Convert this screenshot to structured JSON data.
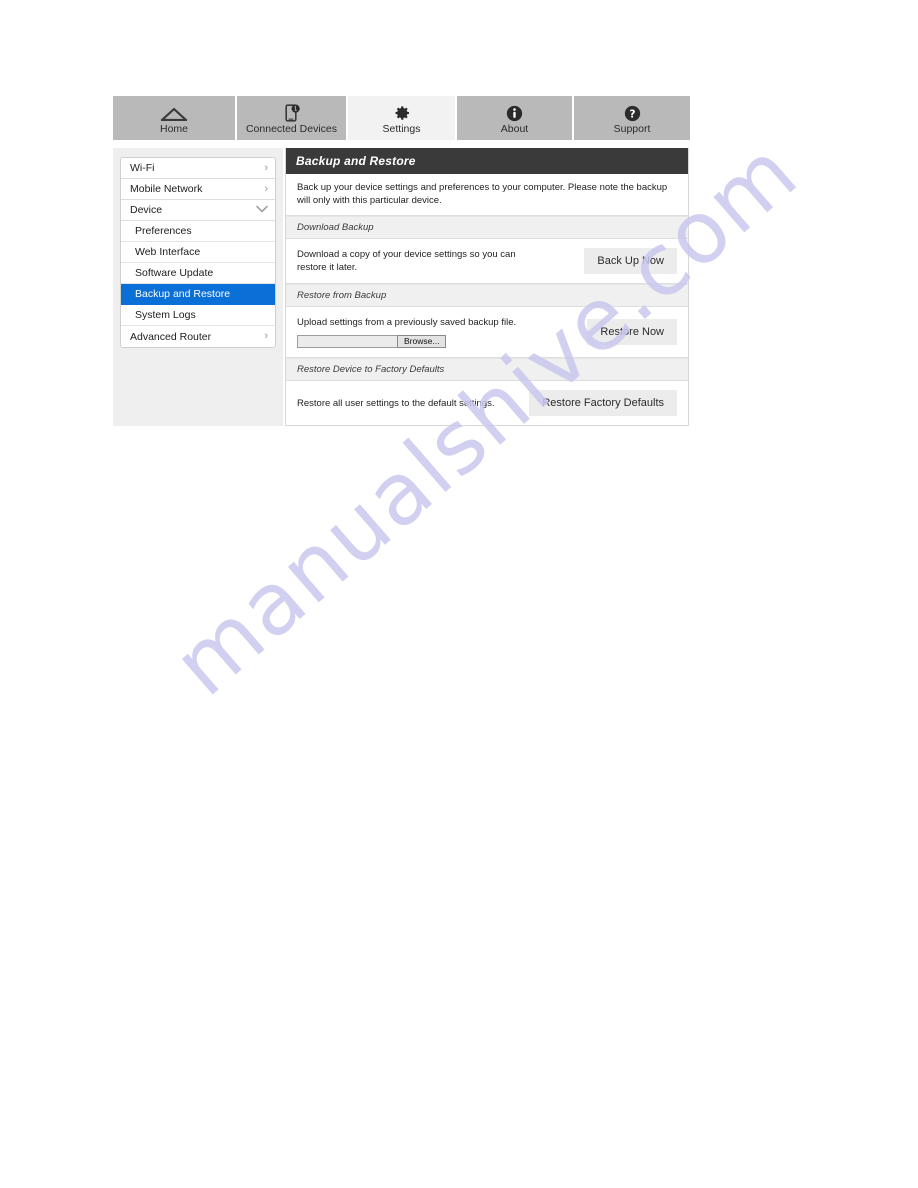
{
  "watermark": {
    "text": "manualshive.com"
  },
  "tabs": [
    {
      "id": "home",
      "label": "Home",
      "icon": "home-icon",
      "active": false
    },
    {
      "id": "connected-devices",
      "label": "Connected Devices",
      "icon": "device-icon",
      "active": false
    },
    {
      "id": "settings",
      "label": "Settings",
      "icon": "gear-icon",
      "active": true
    },
    {
      "id": "about",
      "label": "About",
      "icon": "info-icon",
      "active": false
    },
    {
      "id": "support",
      "label": "Support",
      "icon": "question-icon",
      "active": false
    }
  ],
  "sidebar": {
    "items": [
      {
        "label": "Wi-Fi",
        "level": "top",
        "chevron": "chevron-right",
        "selected": false
      },
      {
        "label": "Mobile Network",
        "level": "top",
        "chevron": "chevron-right",
        "selected": false
      },
      {
        "label": "Device",
        "level": "top",
        "chevron": "chevron-down",
        "selected": false
      },
      {
        "label": "Preferences",
        "level": "sub",
        "chevron": "",
        "selected": false
      },
      {
        "label": "Web Interface",
        "level": "sub",
        "chevron": "",
        "selected": false
      },
      {
        "label": "Software Update",
        "level": "sub",
        "chevron": "",
        "selected": false
      },
      {
        "label": "Backup and Restore",
        "level": "sub",
        "chevron": "",
        "selected": true
      },
      {
        "label": "System Logs",
        "level": "sub",
        "chevron": "",
        "selected": false
      },
      {
        "label": "Advanced Router",
        "level": "top",
        "chevron": "chevron-right",
        "selected": false
      }
    ]
  },
  "panel": {
    "title": "Backup and Restore",
    "intro": "Back up your device settings and preferences to your computer. Please note the backup will only with this particular device.",
    "sections": [
      {
        "heading": "Download Backup",
        "text": "Download a copy of your device settings so you can restore it later.",
        "button": "Back Up Now",
        "has_file_input": false
      },
      {
        "heading": "Restore from Backup",
        "text": "Upload settings from a previously saved backup file.",
        "button": "Restore Now",
        "has_file_input": true,
        "file_value": "",
        "browse_label": "Browse..."
      },
      {
        "heading": "Restore Device to Factory Defaults",
        "text": "Restore all user settings to the default settings.",
        "button": "Restore Factory Defaults",
        "has_file_input": false
      }
    ]
  },
  "colors": {
    "accent_blue": "#0b6fd8",
    "title_bar": "#3a3a3a",
    "tab_bar": "#b9b9b9",
    "active_tab": "#f2f2f2",
    "watermark": "#c9c8ee"
  }
}
